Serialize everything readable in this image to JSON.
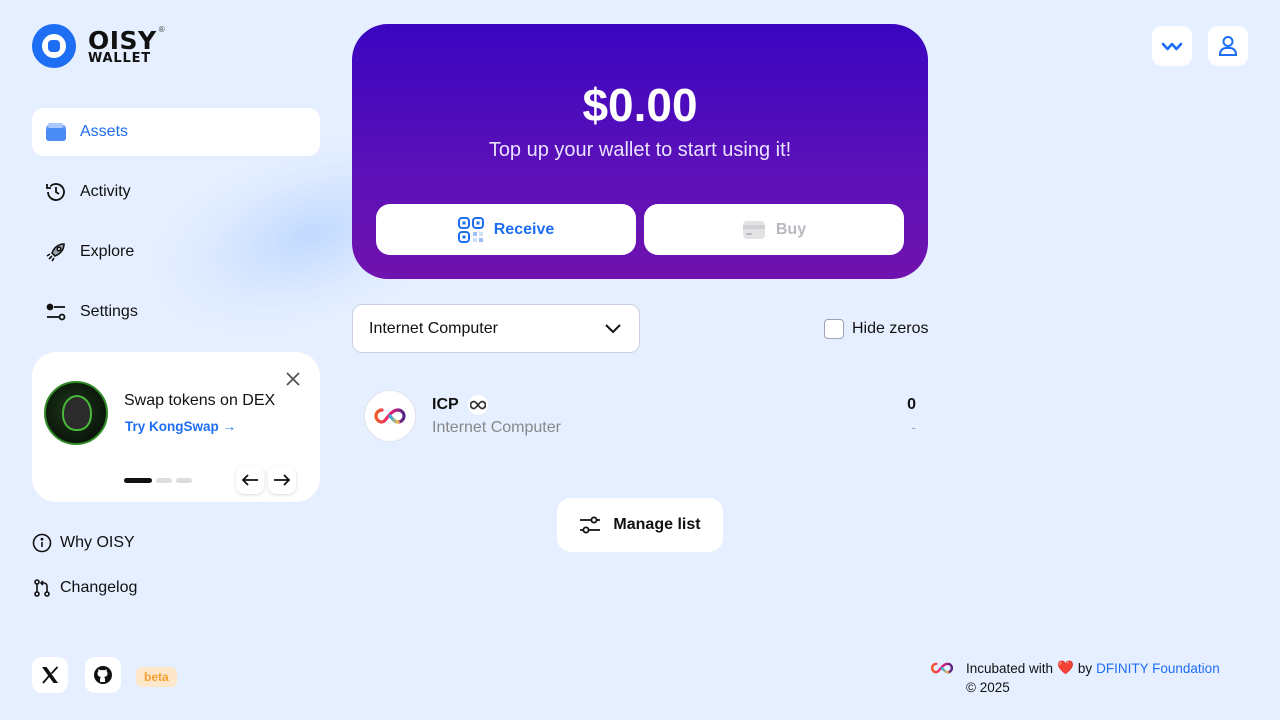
{
  "brand": {
    "line1": "OISY",
    "line2": "WALLET",
    "tm": "®"
  },
  "nav": [
    {
      "label": "Assets"
    },
    {
      "label": "Activity"
    },
    {
      "label": "Explore"
    },
    {
      "label": "Settings"
    }
  ],
  "promo": {
    "title": "Swap tokens on DEX",
    "link": "Try KongSwap →",
    "slides_total": 3,
    "slide_active": 1
  },
  "links": {
    "why": "Why OISY",
    "changelog": "Changelog"
  },
  "badge": {
    "beta": "beta"
  },
  "hero": {
    "amount": "$0.00",
    "subtitle": "Top up your wallet to start using it!",
    "receive": "Receive",
    "buy": "Buy"
  },
  "filters": {
    "network": "Internet Computer",
    "hide_zeros": "Hide zeros",
    "hide_zeros_checked": false
  },
  "tokens": [
    {
      "symbol": "ICP",
      "name": "Internet Computer",
      "balance": "0",
      "usd": "-"
    }
  ],
  "manage_list": "Manage list",
  "footer": {
    "incubated": "Incubated with",
    "by": "by",
    "org": "DFINITY Foundation",
    "copyright": "© 2025"
  },
  "colors": {
    "accent": "#1e6ef4",
    "background": "#e6efff",
    "hero_start": "#3a05c1",
    "hero_end": "#7012ae",
    "beta_bg": "#fde7cb",
    "beta_text": "#f5a030"
  }
}
